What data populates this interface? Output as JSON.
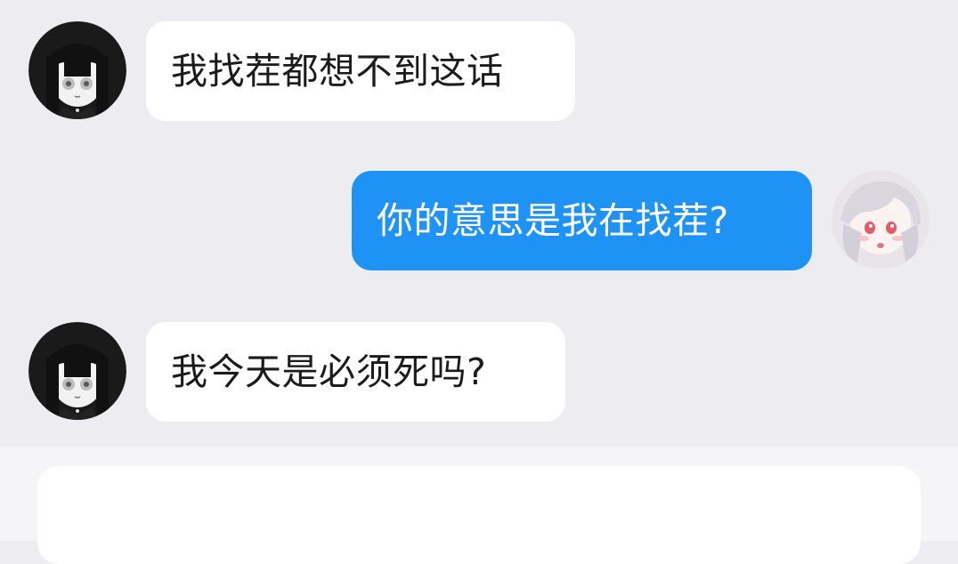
{
  "chat": {
    "messages": [
      {
        "side": "in",
        "avatar": "dark-hair-girl-avatar",
        "text": "我找茬都想不到这话"
      },
      {
        "side": "out",
        "avatar": "white-hair-girl-avatar",
        "text": "你的意思是我在找茬?"
      },
      {
        "side": "in",
        "avatar": "dark-hair-girl-avatar",
        "text": "我今天是必须死吗?"
      }
    ]
  },
  "input": {
    "value": ""
  },
  "colors": {
    "background": "#ececf1",
    "incoming_bubble": "#ffffff",
    "outgoing_bubble": "#1f92f5",
    "input_bar": "#f5f5f7"
  }
}
